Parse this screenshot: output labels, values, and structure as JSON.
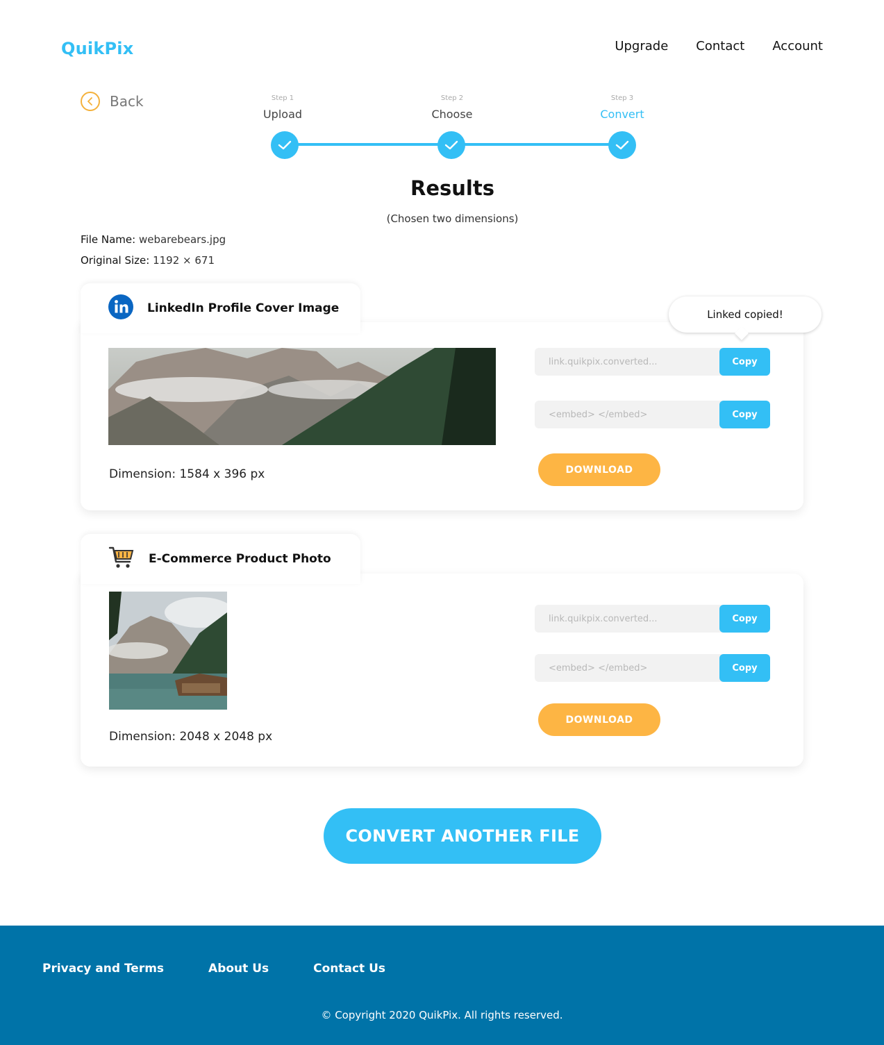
{
  "header": {
    "logo": "QuikPix",
    "nav": [
      "Upgrade",
      "Contact",
      "Account"
    ]
  },
  "back_label": "Back",
  "steps": [
    {
      "small": "Step 1",
      "label": "Upload"
    },
    {
      "small": "Step 2",
      "label": "Choose"
    },
    {
      "small": "Step 3",
      "label": "Convert"
    }
  ],
  "results": {
    "title": "Results",
    "subtitle": "(Chosen two dimensions)"
  },
  "file": {
    "name_label": "File Name:",
    "name_value": "webarebears.jpg",
    "size_label": "Original Size:",
    "size_value": "1192 × 671"
  },
  "cards": [
    {
      "title": "LinkedIn Profile Cover Image",
      "dimension": "Dimension: 1584 x 396 px",
      "link_placeholder": "link.quikpix.converted...",
      "embed_placeholder": "<embed> </embed>",
      "copy_label": "Copy",
      "download_label": "DOWNLOAD"
    },
    {
      "title": "E-Commerce Product Photo",
      "dimension": "Dimension: 2048 x 2048 px",
      "link_placeholder": "link.quikpix.converted...",
      "embed_placeholder": "<embed> </embed>",
      "copy_label": "Copy",
      "download_label": "DOWNLOAD"
    }
  ],
  "tooltip": "Linked copied!",
  "convert_another": "CONVERT ANOTHER FILE",
  "footer": {
    "links": [
      "Privacy and Terms",
      "About Us",
      "Contact Us"
    ],
    "copyright": "© Copyright 2020 QuikPix. All rights reserved."
  },
  "colors": {
    "accent": "#33bff5",
    "download": "#fdb544",
    "footer": "#0073a8",
    "back_ring": "#f4b13b",
    "linkedin": "#0a66c2"
  },
  "icons": [
    "chevron-left-icon",
    "check-icon",
    "linkedin-icon",
    "shopping-cart-icon"
  ]
}
